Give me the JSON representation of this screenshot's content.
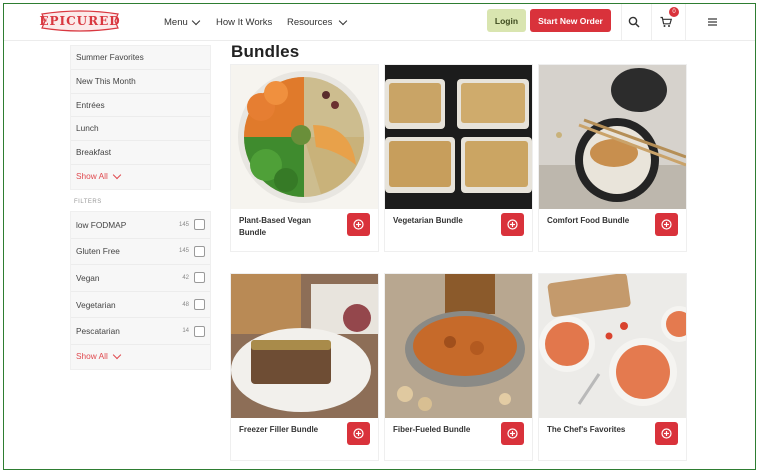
{
  "header": {
    "logo_text": "EPICURED",
    "nav": [
      {
        "label": "Menu",
        "has_dropdown": true
      },
      {
        "label": "How It Works",
        "has_dropdown": false
      },
      {
        "label": "Resources",
        "has_dropdown": true
      }
    ],
    "login_label": "Login",
    "start_order_label": "Start New Order",
    "cart_count": "0",
    "icons": [
      "search-icon",
      "cart-icon",
      "hamburger-menu-icon"
    ],
    "colors": {
      "accent": "#d9323b",
      "login_bg": "#d9e5b0",
      "border": "#2e7d32"
    }
  },
  "sidebar": {
    "categories": [
      "Summer Favorites",
      "New This Month",
      "Entrées",
      "Lunch",
      "Breakfast"
    ],
    "categories_show_all": "Show All",
    "filters_label": "FILTERS",
    "filters": [
      {
        "label": "low FODMAP",
        "count": "145"
      },
      {
        "label": "Gluten Free",
        "count": "145"
      },
      {
        "label": "Vegan",
        "count": "42"
      },
      {
        "label": "Vegetarian",
        "count": "48"
      },
      {
        "label": "Pescatarian",
        "count": "14"
      }
    ],
    "filters_show_all": "Show All"
  },
  "main": {
    "title": "Bundles",
    "bundles": [
      {
        "name": "Plant-Based Vegan Bundle"
      },
      {
        "name": "Vegetarian Bundle"
      },
      {
        "name": "Comfort Food Bundle"
      },
      {
        "name": "Freezer Filler Bundle"
      },
      {
        "name": "Fiber-Fueled Bundle"
      },
      {
        "name": "The Chef's Favorites"
      }
    ]
  }
}
